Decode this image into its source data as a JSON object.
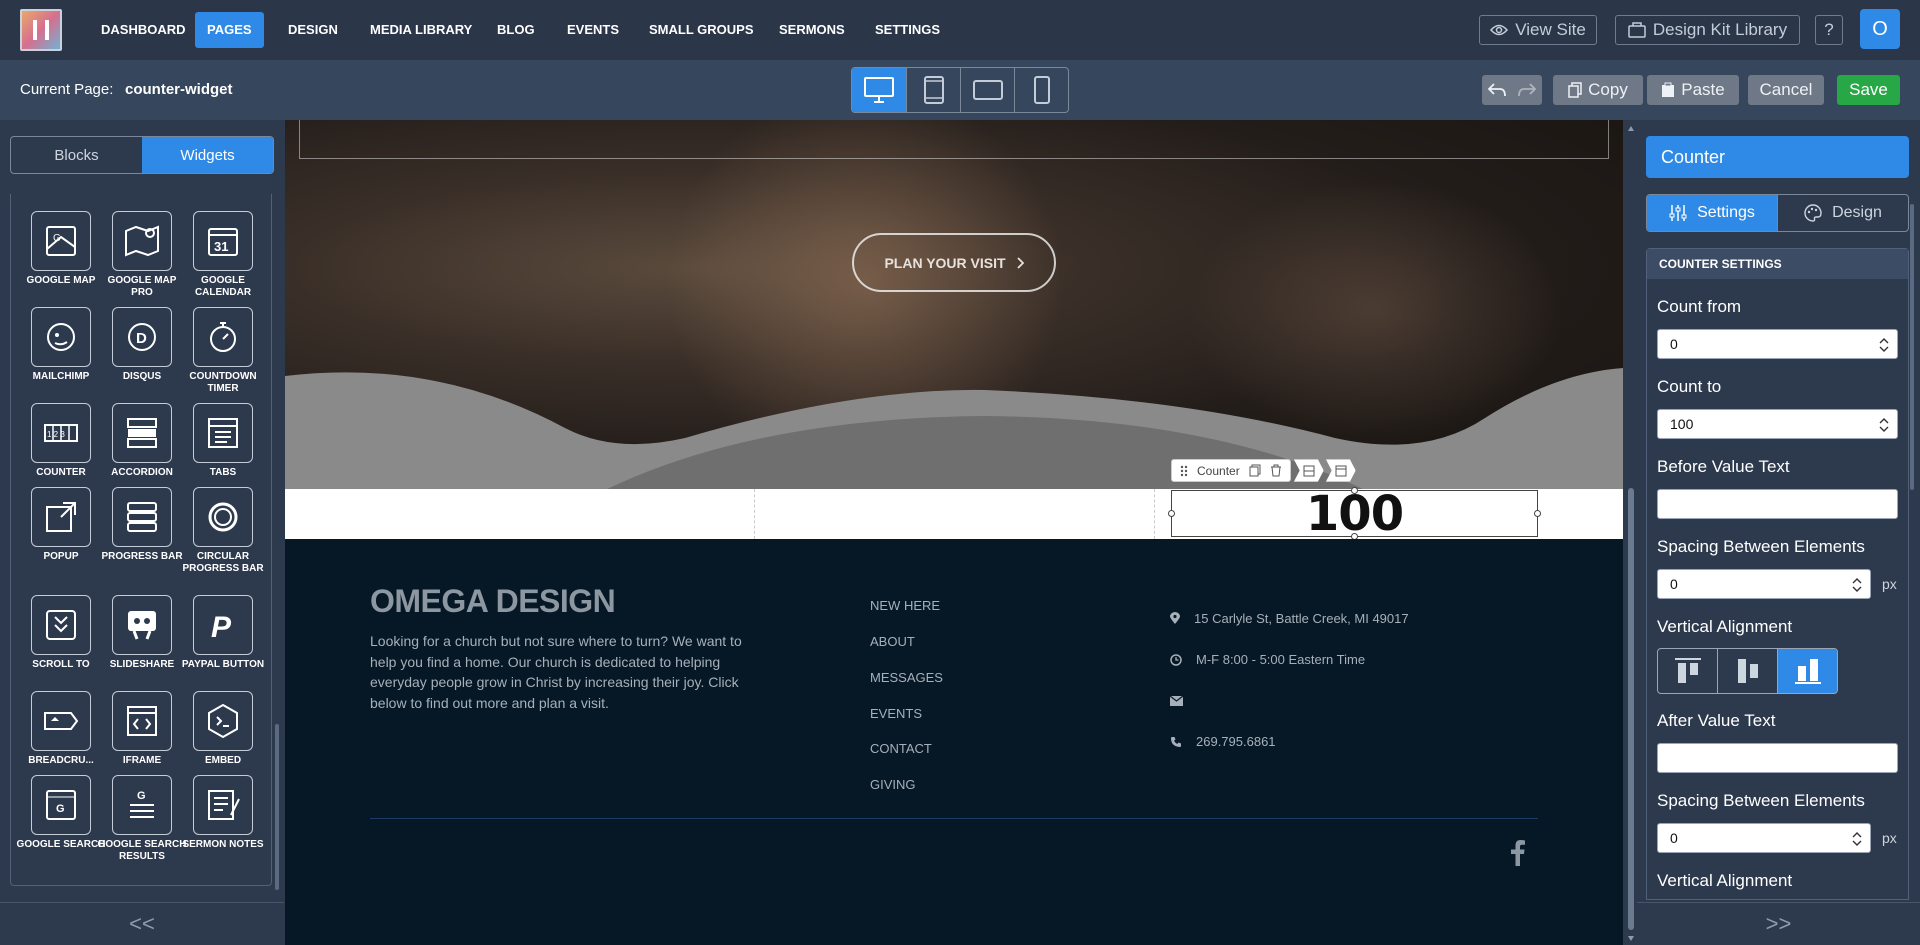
{
  "nav": {
    "items": [
      "DASHBOARD",
      "PAGES",
      "DESIGN",
      "MEDIA LIBRARY",
      "BLOG",
      "EVENTS",
      "SMALL GROUPS",
      "SERMONS",
      "SETTINGS"
    ],
    "active": "PAGES",
    "view_site": "View Site",
    "design_kit": "Design Kit Library",
    "help": "?",
    "user_initial": "O"
  },
  "pagebar": {
    "current_label": "Current Page:",
    "current_value": "counter-widget",
    "copy": "Copy",
    "paste": "Paste",
    "cancel": "Cancel",
    "save": "Save"
  },
  "left": {
    "tabs": [
      "Blocks",
      "Widgets"
    ],
    "active_tab": "Widgets",
    "widgets": [
      {
        "label": "GOOGLE MAP",
        "icon": "google-map-icon"
      },
      {
        "label": "GOOGLE MAP PRO",
        "icon": "google-map-pro-icon"
      },
      {
        "label": "GOOGLE CALENDAR",
        "icon": "calendar-icon"
      },
      {
        "label": "MAILCHIMP",
        "icon": "mailchimp-icon"
      },
      {
        "label": "DISQUS",
        "icon": "disqus-icon"
      },
      {
        "label": "COUNTDOWN TIMER",
        "icon": "stopwatch-icon"
      },
      {
        "label": "COUNTER",
        "icon": "counter-icon"
      },
      {
        "label": "ACCORDION",
        "icon": "accordion-icon"
      },
      {
        "label": "TABS",
        "icon": "tabs-icon"
      },
      {
        "label": "POPUP",
        "icon": "popup-icon"
      },
      {
        "label": "PROGRESS BAR",
        "icon": "progress-bar-icon"
      },
      {
        "label": "CIRCULAR PROGRESS BAR",
        "icon": "circular-progress-icon"
      },
      {
        "label": "SCROLL TO",
        "icon": "scroll-to-icon"
      },
      {
        "label": "SLIDESHARE",
        "icon": "slideshare-icon"
      },
      {
        "label": "PAYPAL BUTTON",
        "icon": "paypal-icon"
      },
      {
        "label": "BREADCRU...",
        "icon": "breadcrumb-icon"
      },
      {
        "label": "IFRAME",
        "icon": "iframe-icon"
      },
      {
        "label": "EMBED",
        "icon": "embed-icon"
      },
      {
        "label": "GOOGLE SEARCH",
        "icon": "google-search-icon"
      },
      {
        "label": "GOOGLE SEARCH RESULTS",
        "icon": "google-search-results-icon"
      },
      {
        "label": "SERMON NOTES",
        "icon": "sermon-notes-icon"
      }
    ],
    "collapse": "<<"
  },
  "canvas": {
    "cta": "PLAN YOUR VISIT",
    "toolbar_label": "Counter",
    "counter_value": "100",
    "footer": {
      "brand": "OMEGA DESIGN",
      "description": "Looking for a church but not sure where to turn? We want to help you find a home. Our church is dedicated to helping everyday people grow in Christ by increasing their joy.  Click below to find out more and plan a visit.",
      "links": [
        "NEW HERE",
        "ABOUT",
        "MESSAGES",
        "EVENTS",
        "CONTACT",
        "GIVING"
      ],
      "address": "15 Carlyle St, Battle Creek, MI 49017",
      "hours": "M-F 8:00 - 5:00 Eastern Time",
      "email": "",
      "phone": "269.795.6861"
    }
  },
  "right": {
    "title": "Counter",
    "tabs": [
      "Settings",
      "Design"
    ],
    "active_tab": "Settings",
    "section": "COUNTER SETTINGS",
    "count_from_label": "Count from",
    "count_from": "0",
    "count_to_label": "Count to",
    "count_to": "100",
    "before_label": "Before Value Text",
    "before_value": "",
    "spacing1_label": "Spacing Between Elements",
    "spacing1": "0",
    "unit": "px",
    "valign1_label": "Vertical Alignment",
    "valign_selected": "bottom",
    "after_label": "After Value Text",
    "after_value": "",
    "spacing2_label": "Spacing Between Elements",
    "spacing2": "0",
    "valign2_label": "Vertical Alignment",
    "expand": ">>"
  },
  "colors": {
    "accent": "#2e8ae6",
    "save": "#27a745",
    "nav_bg": "#2b3648",
    "footer_bg": "#061825"
  }
}
